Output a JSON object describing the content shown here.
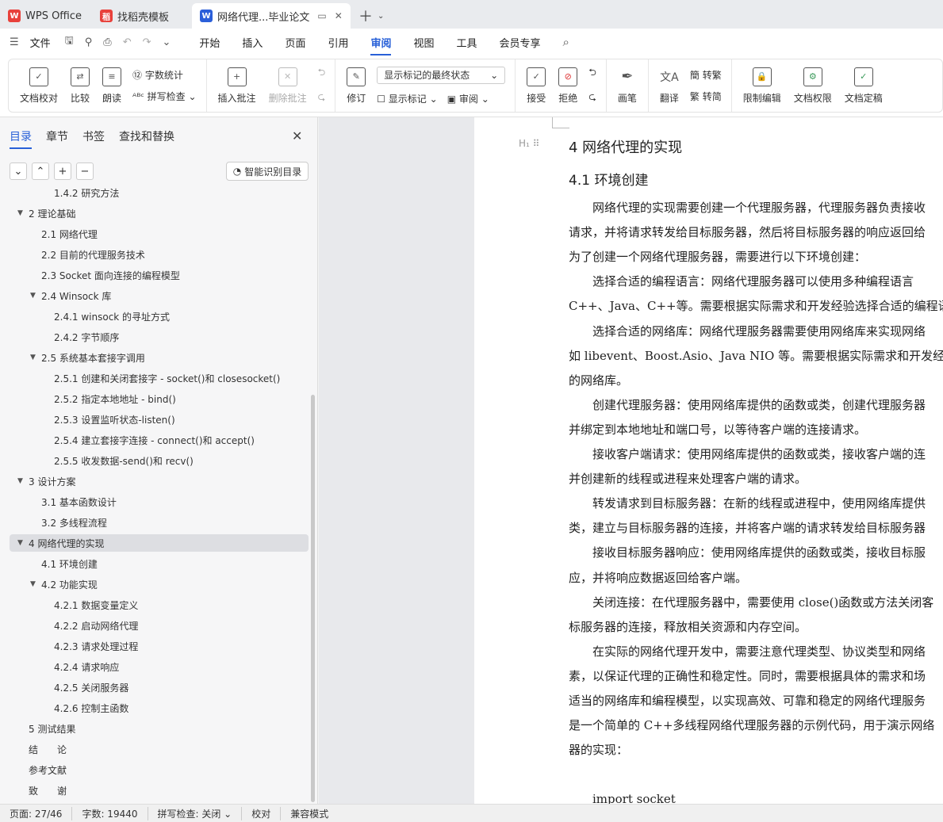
{
  "tabs": [
    {
      "label": "WPS Office",
      "icon": "wps-logo-icon",
      "color": "#e8413b"
    },
    {
      "label": "找稻壳模板",
      "icon": "docer-icon",
      "color": "#e8413b"
    },
    {
      "label": "网络代理...毕业论文",
      "icon": "word-doc-icon",
      "color": "#2b5fd9"
    }
  ],
  "menu": {
    "file": "文件",
    "items": [
      "开始",
      "插入",
      "页面",
      "引用",
      "审阅",
      "视图",
      "工具",
      "会员专享"
    ],
    "active": "审阅"
  },
  "ribbon": {
    "doc_check": "文档校对",
    "compare": "比较",
    "read_aloud": "朗读",
    "word_count": "字数统计",
    "spell_check": "拼写检查",
    "insert_comment": "插入批注",
    "delete_comment": "删除批注",
    "revise": "修订",
    "display_state": "显示标记的最终状态",
    "show_markup": "显示标记",
    "review": "审阅",
    "accept": "接受",
    "reject": "拒绝",
    "pen": "画笔",
    "translate": "翻译",
    "to_traditional": "转繁",
    "to_simplified": "转简",
    "restrict_edit": "限制编辑",
    "doc_permission": "文档权限",
    "doc_finalize": "文档定稿"
  },
  "panel": {
    "tabs": [
      "目录",
      "章节",
      "书签",
      "查找和替换"
    ],
    "smart_toc": "智能识别目录",
    "toc": [
      {
        "label": "1.4.2 研究方法",
        "level": 3,
        "arrow": ""
      },
      {
        "label": "2 理论基础",
        "level": 1,
        "arrow": "▼"
      },
      {
        "label": "2.1 网络代理",
        "level": 2,
        "arrow": ""
      },
      {
        "label": "2.2 目前的代理服务技术",
        "level": 2,
        "arrow": ""
      },
      {
        "label": "2.3 Socket 面向连接的编程模型",
        "level": 2,
        "arrow": ""
      },
      {
        "label": "2.4 Winsock 库",
        "level": 2,
        "arrow": "▼"
      },
      {
        "label": "2.4.1 winsock 的寻址方式",
        "level": 3,
        "arrow": ""
      },
      {
        "label": "2.4.2 字节顺序",
        "level": 3,
        "arrow": ""
      },
      {
        "label": "2.5 系统基本套接字调用",
        "level": 2,
        "arrow": "▼"
      },
      {
        "label": "2.5.1 创建和关闭套接字 - socket()和 closesocket()",
        "level": 3,
        "arrow": ""
      },
      {
        "label": "2.5.2 指定本地地址 - bind()",
        "level": 3,
        "arrow": ""
      },
      {
        "label": "2.5.3 设置监听状态-listen()",
        "level": 3,
        "arrow": ""
      },
      {
        "label": "2.5.4 建立套接字连接 - connect()和 accept()",
        "level": 3,
        "arrow": ""
      },
      {
        "label": "2.5.5 收发数据-send()和 recv()",
        "level": 3,
        "arrow": ""
      },
      {
        "label": "3 设计方案",
        "level": 1,
        "arrow": "▼"
      },
      {
        "label": "3.1 基本函数设计",
        "level": 2,
        "arrow": ""
      },
      {
        "label": "3.2 多线程流程",
        "level": 2,
        "arrow": ""
      },
      {
        "label": "4 网络代理的实现",
        "level": 1,
        "arrow": "▼",
        "selected": true
      },
      {
        "label": "4.1 环境创建",
        "level": 2,
        "arrow": ""
      },
      {
        "label": "4.2 功能实现",
        "level": 2,
        "arrow": "▼"
      },
      {
        "label": "4.2.1 数据变量定义",
        "level": 3,
        "arrow": ""
      },
      {
        "label": "4.2.2 启动网络代理",
        "level": 3,
        "arrow": ""
      },
      {
        "label": "4.2.3 请求处理过程",
        "level": 3,
        "arrow": ""
      },
      {
        "label": "4.2.4 请求响应",
        "level": 3,
        "arrow": ""
      },
      {
        "label": "4.2.5 关闭服务器",
        "level": 3,
        "arrow": ""
      },
      {
        "label": "4.2.6 控制主函数",
        "level": 3,
        "arrow": ""
      },
      {
        "label": "5 测试结果",
        "level": 1,
        "arrow": ""
      },
      {
        "label": "结　　论",
        "level": 1,
        "arrow": ""
      },
      {
        "label": "参考文献",
        "level": 1,
        "arrow": ""
      },
      {
        "label": "致　　谢",
        "level": 1,
        "arrow": ""
      }
    ]
  },
  "document": {
    "heading_mark": "H₁",
    "h1": "4 网络代理的实现",
    "h2": "4.1 环境创建",
    "lines": [
      "　　网络代理的实现需要创建一个代理服务器，代理服务器负责接收",
      "请求，并将请求转发给目标服务器，然后将目标服务器的响应返回给",
      "为了创建一个网络代理服务器，需要进行以下环境创建：",
      "　　选择合适的编程语言：网络代理服务器可以使用多种编程语言",
      "C++、Java、C++等。需要根据实际需求和开发经验选择合适的编程语",
      "　　选择合适的网络库：网络代理服务器需要使用网络库来实现网络",
      "如 libevent、Boost.Asio、Java NIO 等。需要根据实际需求和开发经验",
      "的网络库。",
      "　　创建代理服务器：使用网络库提供的函数或类，创建代理服务器",
      "并绑定到本地地址和端口号，以等待客户端的连接请求。",
      "　　接收客户端请求：使用网络库提供的函数或类，接收客户端的连",
      "并创建新的线程或进程来处理客户端的请求。",
      "　　转发请求到目标服务器：在新的线程或进程中，使用网络库提供",
      "类，建立与目标服务器的连接，并将客户端的请求转发给目标服务器",
      "　　接收目标服务器响应：使用网络库提供的函数或类，接收目标服",
      "应，并将响应数据返回给客户端。",
      "　　关闭连接：在代理服务器中，需要使用 close()函数或方法关闭客",
      "标服务器的连接，释放相关资源和内存空间。",
      "　　在实际的网络代理开发中，需要注意代理类型、协议类型和网络",
      "素，以保证代理的正确性和稳定性。同时，需要根据具体的需求和场",
      "适当的网络库和编程模型，以实现高效、可靠和稳定的网络代理服务",
      "是一个简单的 C++多线程网络代理服务器的示例代码，用于演示网络",
      "器的实现：",
      "",
      "　　import socket"
    ]
  },
  "status": {
    "page": "页面: 27/46",
    "words": "字数: 19440",
    "spell": "拼写检查: 关闭",
    "proof": "校对",
    "compat": "兼容模式"
  }
}
